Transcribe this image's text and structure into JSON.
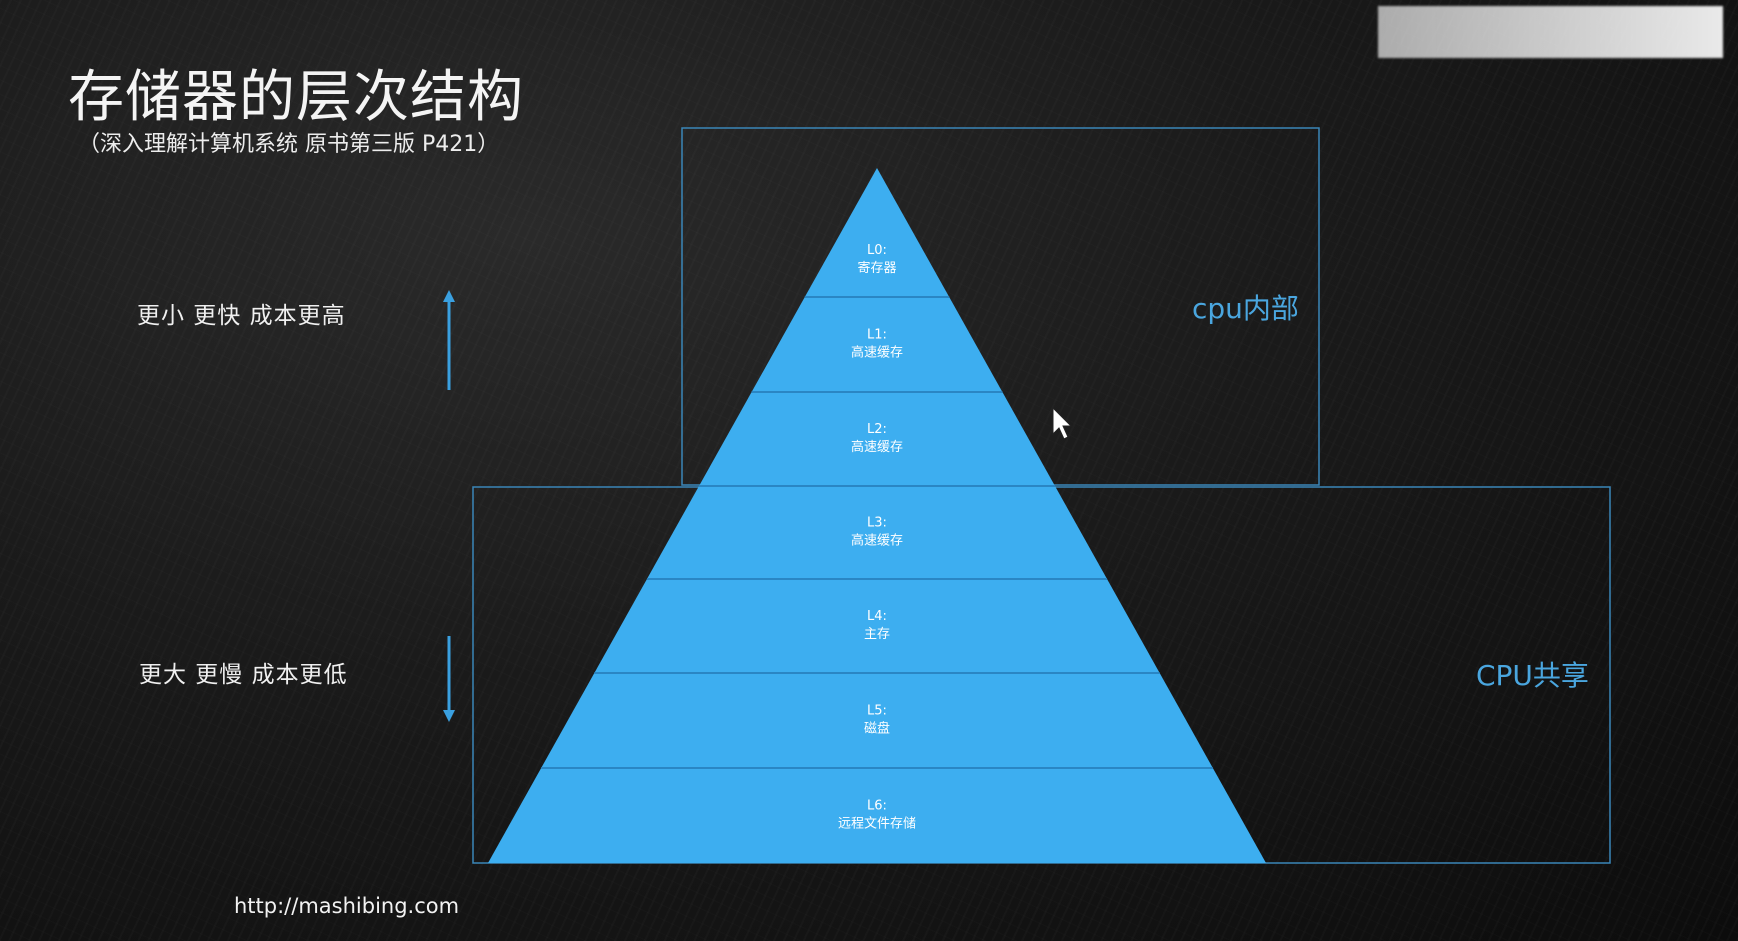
{
  "title": "存储器的层次结构",
  "subtitle": "（深入理解计算机系统 原书第三版 P421）",
  "side_labels": {
    "top": "更小 更快 成本更高",
    "bottom": "更大 更慢 成本更低"
  },
  "regions": {
    "inner": "cpu内部",
    "shared": "CPU共享"
  },
  "levels": [
    {
      "id": "L0:",
      "name": "寄存器"
    },
    {
      "id": "L1:",
      "name": "高速缓存"
    },
    {
      "id": "L2:",
      "name": "高速缓存"
    },
    {
      "id": "L3:",
      "name": "高速缓存"
    },
    {
      "id": "L4:",
      "name": "主存"
    },
    {
      "id": "L5:",
      "name": "磁盘"
    },
    {
      "id": "L6:",
      "name": "远程文件存储"
    }
  ],
  "footer_url": "http://mashibing.com",
  "colors": {
    "pyramid_fill": "#3daef0",
    "pyramid_divider": "#2a86c4",
    "region_border": "#3a86b8",
    "region_text": "#4aa6df",
    "arrow": "#3aa0e0"
  },
  "icons": {
    "up_arrow": "up-arrow-icon",
    "down_arrow": "down-arrow-icon",
    "cursor": "mouse-pointer-icon"
  }
}
